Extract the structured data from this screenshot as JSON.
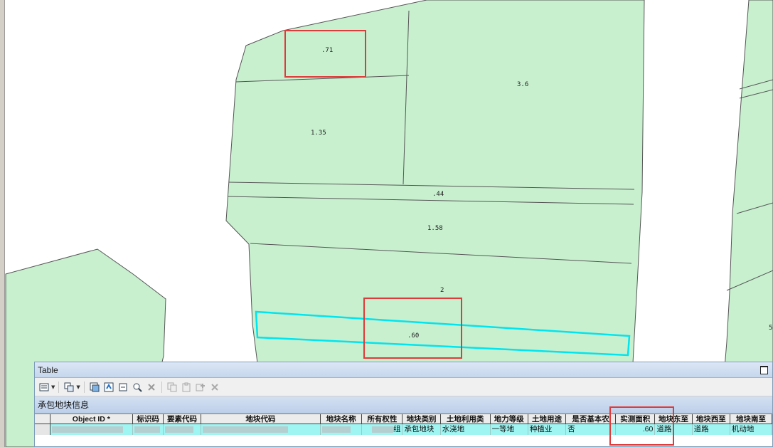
{
  "map": {
    "parcel_labels": {
      "p071": ".71",
      "p36": "3.6",
      "p135": "1.35",
      "p044": ".44",
      "p158": "1.58",
      "p2": "2",
      "p060": ".60",
      "p5": "5"
    }
  },
  "table_window": {
    "title": "Table",
    "tab_label": "承包地块信息",
    "columns": [
      "Object ID *",
      "标识码",
      "要素代码",
      "地块代码",
      "地块名称",
      "所有权性",
      "地块类别",
      "土地利用类",
      "地力等级",
      "土地用途",
      "是否基本农",
      "实测面积",
      "地块东至",
      "地块西至",
      "地块南至"
    ],
    "row": {
      "object_id": "",
      "bsm": "",
      "ysdm": "",
      "dkdm": "",
      "dkmc": "",
      "syqxz": "组",
      "dklb": "承包地块",
      "tdlylx": "水浇地",
      "dldj": "一等地",
      "tdyt": "种植业",
      "sfjbnt": "否",
      "scmj": ".60",
      "dkdz": "道路",
      "dkxz": "道路",
      "dknz": "机动地"
    }
  },
  "colors": {
    "parcel_fill": "#c8f0cf",
    "parcel_stroke": "#555555",
    "selection": "#00e5ee",
    "highlight": "#e03a3a",
    "row_selected": "#9ff5f2"
  },
  "icons": {
    "toolbar": [
      "table-options-icon",
      "related-tables-icon",
      "select-by-attributes-icon",
      "switch-selection-icon",
      "clear-selection-icon",
      "zoom-to-selected-icon",
      "delete-selected-icon",
      "copy-icon",
      "paste-icon",
      "add-icon",
      "remove-icon"
    ]
  }
}
